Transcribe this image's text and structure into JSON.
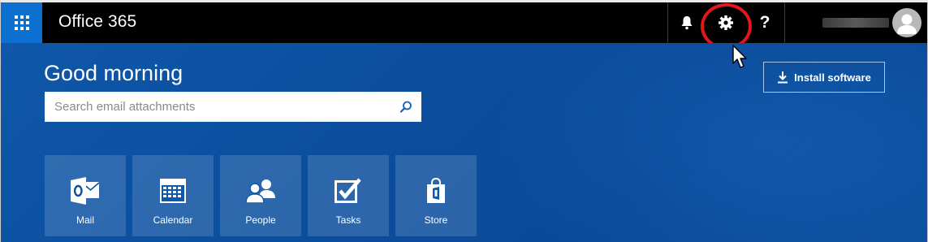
{
  "header": {
    "app_title": "Office 365",
    "waffle_icon": "app-launcher-icon",
    "notifications_icon": "bell-icon",
    "settings_icon": "gear-icon",
    "help_label": "?",
    "avatar_icon": "person-icon",
    "accent_color": "#0d6fcf",
    "highlight_color": "#e4161b"
  },
  "main": {
    "greeting": "Good morning",
    "search": {
      "placeholder": "Search email attachments",
      "value": ""
    },
    "install_label": "Install software",
    "tiles": [
      {
        "label": "Mail",
        "icon": "outlook-mail-icon"
      },
      {
        "label": "Calendar",
        "icon": "calendar-icon"
      },
      {
        "label": "People",
        "icon": "people-icon"
      },
      {
        "label": "Tasks",
        "icon": "tasks-checkbox-icon"
      },
      {
        "label": "Store",
        "icon": "store-bag-icon"
      }
    ]
  }
}
